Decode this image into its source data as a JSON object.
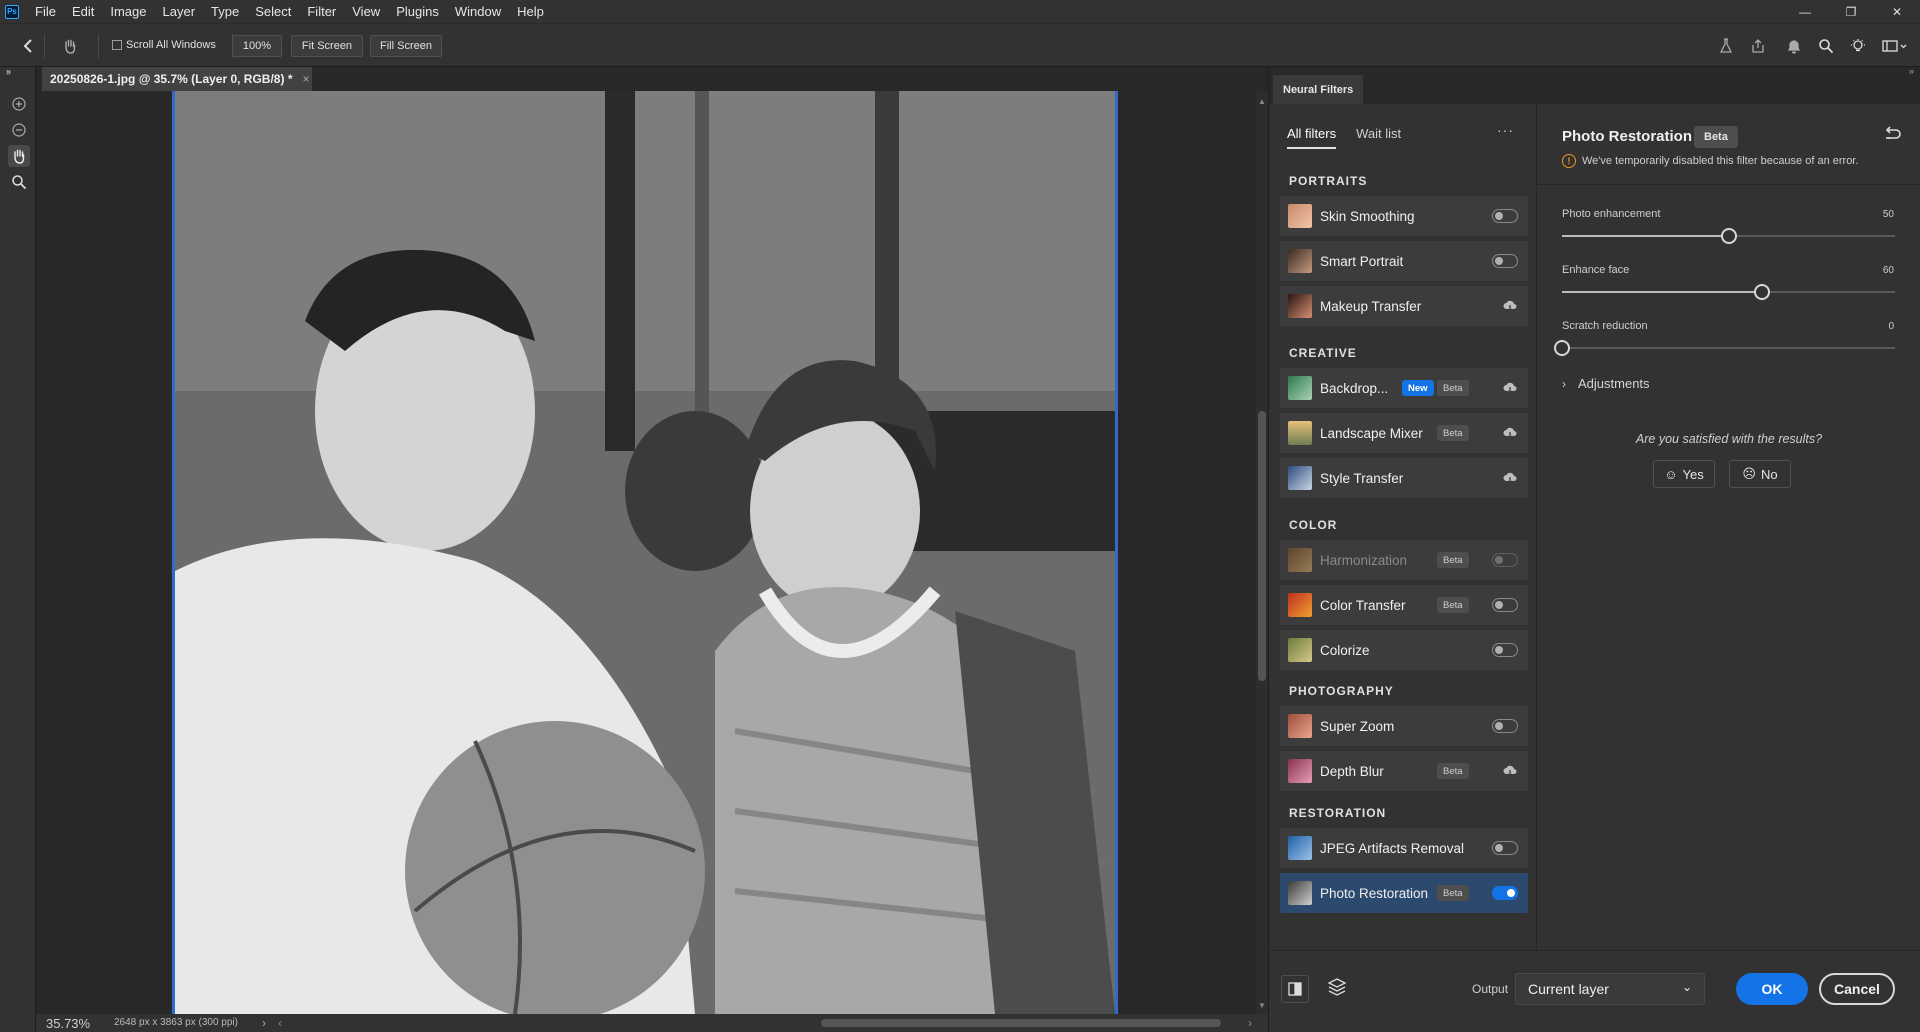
{
  "menubar": {
    "app_logo": "Ps",
    "items": [
      "File",
      "Edit",
      "Image",
      "Layer",
      "Type",
      "Select",
      "Filter",
      "View",
      "Plugins",
      "Window",
      "Help"
    ]
  },
  "optionsbar": {
    "scroll_all_windows": "Scroll All Windows",
    "zoom_value": "100%",
    "fit_screen": "Fit Screen",
    "fill_screen": "Fill Screen"
  },
  "document": {
    "tab_title": "20250826-1.jpg @ 35.7% (Layer 0, RGB/8) *",
    "close_glyph": "×"
  },
  "status": {
    "zoom": "35.73%",
    "dimensions": "2648 px x 3863 px (300 ppi)"
  },
  "panel": {
    "title": "Neural Filters",
    "tabs": {
      "all": "All filters",
      "waitlist": "Wait list"
    },
    "more": "···",
    "sections": {
      "portraits": "PORTRAITS",
      "creative": "CREATIVE",
      "color": "COLOR",
      "photography": "PHOTOGRAPHY",
      "restoration": "RESTORATION"
    },
    "filters": [
      {
        "label": "Skin Smoothing",
        "state": "off"
      },
      {
        "label": "Smart Portrait",
        "state": "off"
      },
      {
        "label": "Makeup Transfer",
        "state": "download"
      },
      {
        "label": "Backdrop...",
        "badge_new": "New",
        "badge_beta": "Beta",
        "state": "download"
      },
      {
        "label": "Landscape Mixer",
        "badge_beta": "Beta",
        "state": "download"
      },
      {
        "label": "Style Transfer",
        "state": "download"
      },
      {
        "label": "Harmonization",
        "badge_beta": "Beta",
        "state": "disabled"
      },
      {
        "label": "Color Transfer",
        "badge_beta": "Beta",
        "state": "off"
      },
      {
        "label": "Colorize",
        "state": "off"
      },
      {
        "label": "Super Zoom",
        "state": "off"
      },
      {
        "label": "Depth Blur",
        "badge_beta": "Beta",
        "state": "download"
      },
      {
        "label": "JPEG Artifacts Removal",
        "state": "off"
      },
      {
        "label": "Photo Restoration",
        "badge_beta": "Beta",
        "state": "on"
      }
    ]
  },
  "detail": {
    "title": "Photo Restoration",
    "badge": "Beta",
    "error": "We've temporarily disabled this filter because of an error.",
    "sliders": [
      {
        "label": "Photo enhancement",
        "value": 50,
        "max": 100
      },
      {
        "label": "Enhance face",
        "value": 60,
        "max": 100
      },
      {
        "label": "Scratch reduction",
        "value": 0,
        "max": 100
      }
    ],
    "adjustments": "Adjustments",
    "satisfied": "Are you satisfied with the results?",
    "yes": "Yes",
    "no": "No"
  },
  "bottom": {
    "output_label": "Output",
    "output_value": "Current layer",
    "ok": "OK",
    "cancel": "Cancel"
  },
  "colors": {
    "accent": "#1473e6",
    "panel": "#323232",
    "canvas": "#282828"
  }
}
